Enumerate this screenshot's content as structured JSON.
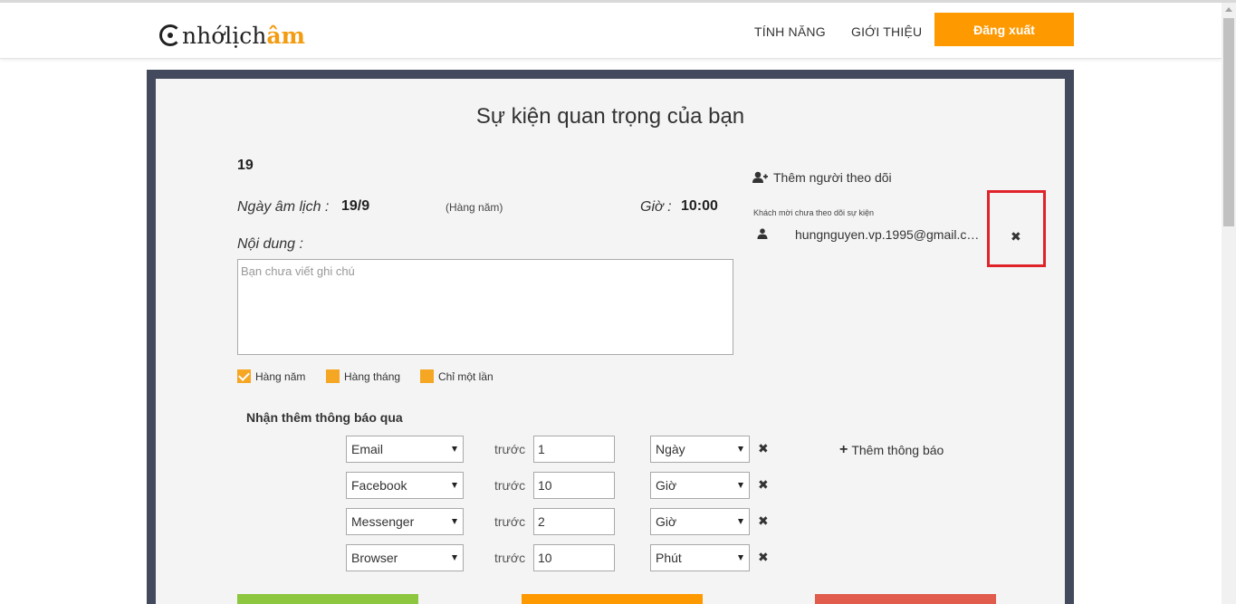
{
  "header": {
    "logo_text_main": "nhớlịch",
    "logo_text_accent": "âm",
    "nav": [
      "TÍNH NĂNG",
      "GIỚI THIỆU"
    ],
    "logout_label": "Đăng xuất",
    "accent_color": "#ff9900"
  },
  "event": {
    "page_title": "Sự kiện quan trọng của bạn",
    "name": "19",
    "lunar_label": "Ngày âm lịch :",
    "lunar_value": "19/9",
    "repeat_label": "(Hàng năm)",
    "time_label": "Giờ :",
    "time_value": "10:00",
    "content_label": "Nội dung :",
    "note_placeholder": "Bạn chưa viết ghi chú",
    "repeat_options": [
      {
        "label": "Hàng năm",
        "checked": true
      },
      {
        "label": "Hàng tháng",
        "checked": false
      },
      {
        "label": "Chỉ một lần",
        "checked": false
      }
    ]
  },
  "followers": {
    "add_label": "Thêm người theo dõi",
    "guest_note": "Khách mời chưa theo dõi sự kiện",
    "guests": [
      {
        "email": "hungnguyen.vp.1995@gmail.com",
        "remove_icon": "close-icon"
      }
    ]
  },
  "notifications": {
    "title": "Nhận thêm thông báo qua",
    "before_label": "trước",
    "add_label": "Thêm thông báo",
    "rows": [
      {
        "channel": "Email",
        "amount": "1",
        "unit": "Ngày"
      },
      {
        "channel": "Facebook",
        "amount": "10",
        "unit": "Giờ"
      },
      {
        "channel": "Messenger",
        "amount": "2",
        "unit": "Giờ"
      },
      {
        "channel": "Browser",
        "amount": "10",
        "unit": "Phút"
      }
    ]
  }
}
